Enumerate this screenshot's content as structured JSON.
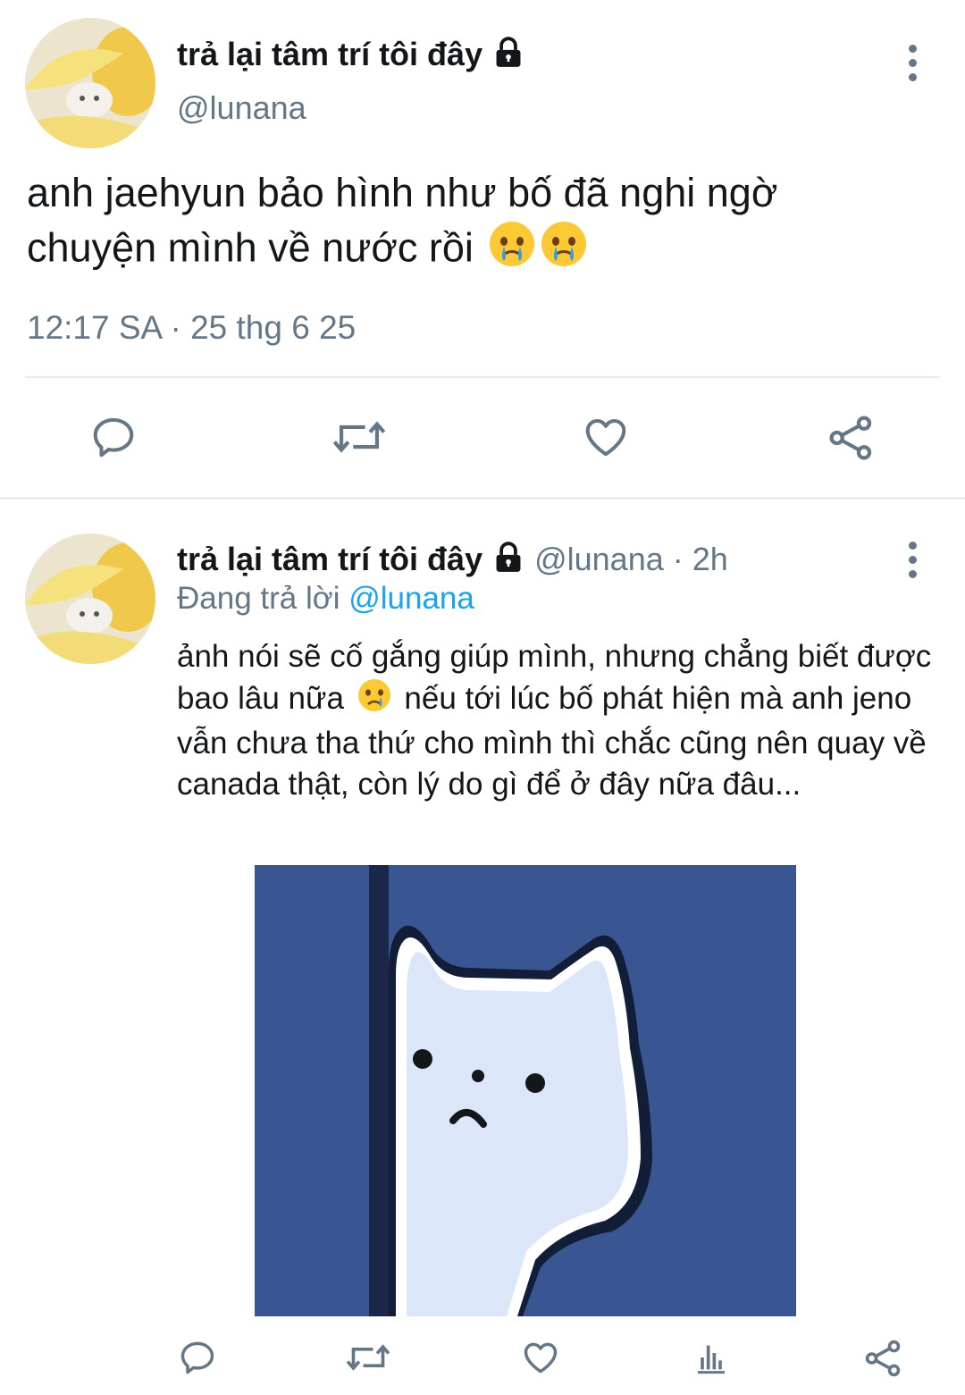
{
  "main_tweet": {
    "display_name": "trả lại tâm trí tôi đây",
    "handle": "@lunana",
    "text_line1": "anh jaehyun bảo hình như bố đã nghi ngờ",
    "text_line2": "chuyện mình về nước rồi",
    "emoji_icons": [
      "face-holding-back-tears-icon",
      "face-holding-back-tears-icon"
    ],
    "timestamp": "12:17 SA · 25 thg 6 25",
    "actions": [
      "reply-icon",
      "retweet-icon",
      "like-icon",
      "share-icon"
    ]
  },
  "reply_tweet": {
    "display_name": "trả lại tâm trí tôi đây",
    "handle": "@lunana",
    "separator": " · ",
    "time_ago": "2h",
    "replying_to_prefix": "Đang trả lời",
    "replying_to_handle": "@lunana",
    "text_part1": "ảnh nói sẽ cố gắng giúp mình, nhưng chẳng biết được bao lâu nữa",
    "text_part2": "nếu tới lúc bố phát hiện mà anh jeno vẫn chưa tha thứ cho mình thì chắc cũng nên quay về canada thật, còn lý do gì để ở đây nữa đâu...",
    "emoji_icon": "sad-crying-face-icon",
    "media_icon": "sad-white-cat-image",
    "actions": [
      "reply-icon",
      "retweet-icon",
      "like-icon",
      "analytics-icon",
      "share-icon"
    ]
  },
  "colors": {
    "text": "#14171a",
    "secondary": "#657786",
    "link": "#1da1f2",
    "divider": "#e6ecf0",
    "media_background": "#3a5692"
  }
}
